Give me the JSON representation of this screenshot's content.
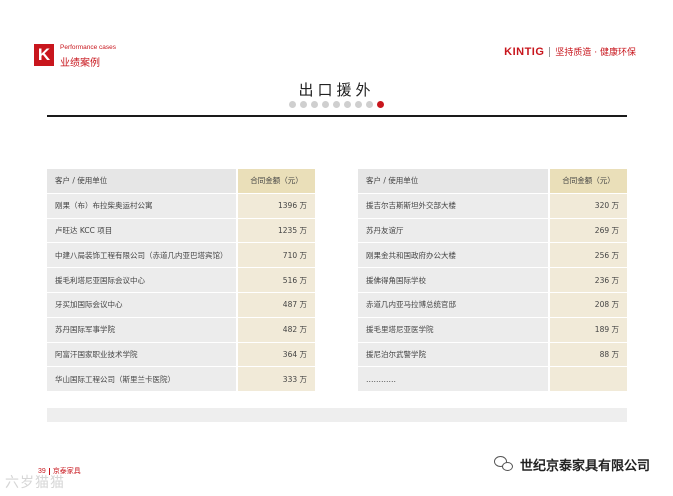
{
  "header": {
    "logo_letter": "K",
    "section_en": "Performance cases",
    "section_cn": "业绩案例",
    "brand_name": "KINTIG",
    "brand_slogan": "坚持质造 · 健康环保"
  },
  "page_title": "出口援外",
  "pager": {
    "total": 9,
    "active_index": 8
  },
  "left_table": {
    "columns": [
      "客户 / 使用单位",
      "合同金额（元）"
    ],
    "rows": [
      [
        "刚果（布）布拉柴奥运村公寓",
        "1396 万"
      ],
      [
        "卢旺达 KCC 项目",
        "1235 万"
      ],
      [
        "中建八局装饰工程有限公司（赤道几内亚巴塔宾馆）",
        "710 万"
      ],
      [
        "援毛利塔尼亚国际会议中心",
        "516 万"
      ],
      [
        "牙买加国际会议中心",
        "487 万"
      ],
      [
        "苏丹国际军事学院",
        "482 万"
      ],
      [
        "阿富汗国家职业技术学院",
        "364 万"
      ],
      [
        "华山国际工程公司（斯里兰卡医院）",
        "333 万"
      ]
    ]
  },
  "right_table": {
    "columns": [
      "客户 / 使用单位",
      "合同金额（元）"
    ],
    "rows": [
      [
        "援吉尔吉斯斯坦外交部大楼",
        "320 万"
      ],
      [
        "苏丹友谊厅",
        "269 万"
      ],
      [
        "刚果金共和国政府办公大楼",
        "256 万"
      ],
      [
        "援佛得角国际学校",
        "236 万"
      ],
      [
        "赤道几内亚马拉博总统官邸",
        "208 万"
      ],
      [
        "援毛里塔尼亚医学院",
        "189 万"
      ],
      [
        "援尼泊尔武警学院",
        "88 万"
      ],
      [
        "…………",
        ""
      ]
    ]
  },
  "footer": {
    "page_number": "39",
    "footer_brand": "京泰家具",
    "watermark": "六岁猫猫",
    "company": "世纪京泰家具有限公司"
  }
}
